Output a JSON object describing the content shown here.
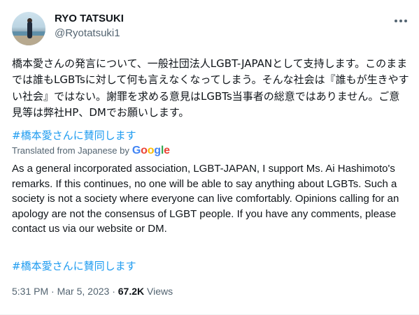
{
  "author": {
    "name": "RYO TATSUKI",
    "handle": "@Ryotatsuki1"
  },
  "tweet": {
    "original_text": "橋本愛さんの発言について、一般社団法人LGBT-JAPANとして支持します。このままでは誰もLGBTsに対して何も言えなくなってしまう。そんな社会は『誰もが生きやすい社会』ではない。謝罪を求める意見はLGBTs当事者の総意ではありません。ご意見等は弊社HP、DMでお願いします。",
    "hashtag": "#橋本愛さんに賛同します",
    "translated_from": "Translated from Japanese by",
    "translator": "Google",
    "translated_text": "As a general incorporated association, LGBT-JAPAN, I support Ms. Ai Hashimoto's remarks. If this continues, no one will be able to say anything about LGBTs. Such a society is not a society where everyone can live comfortably. Opinions calling for an apology are not the consensus of LGBT people. If you have any comments, please contact us via our website or DM.",
    "translated_hashtag": "#橋本愛さんに賛同します"
  },
  "meta": {
    "time": "5:31 PM",
    "separator": "·",
    "date": "Mar 5, 2023",
    "views_count": "67.2K",
    "views_label": "Views"
  },
  "icons": {
    "more": "more-options-icon"
  }
}
